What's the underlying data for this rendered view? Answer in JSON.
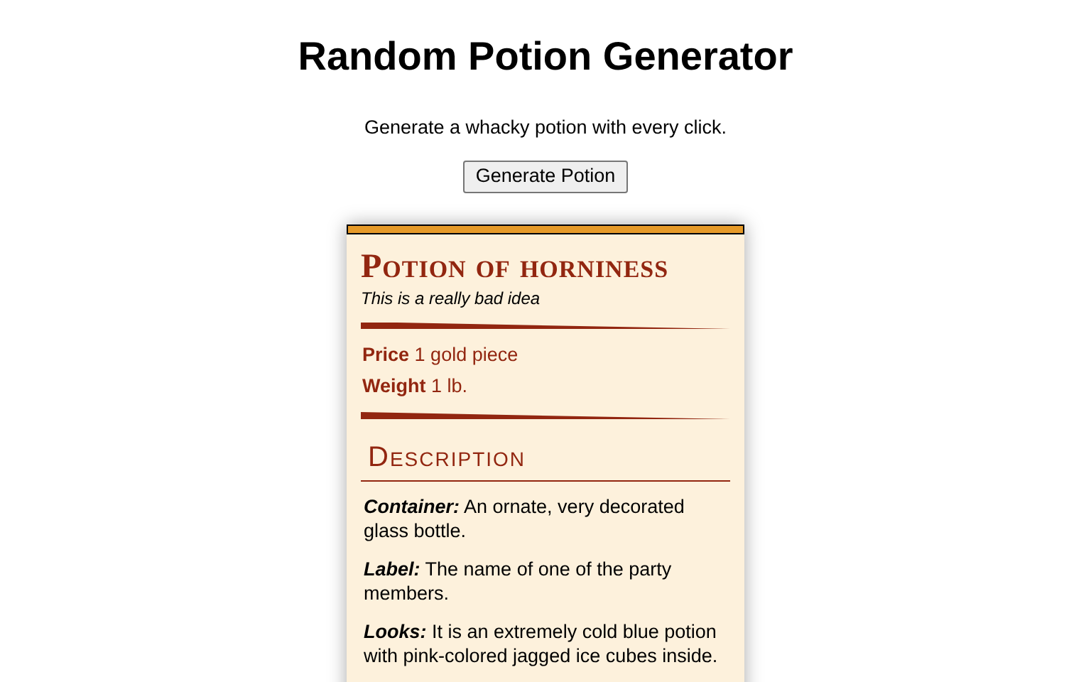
{
  "page": {
    "title": "Random Potion Generator",
    "subtitle": "Generate a whacky potion with every click."
  },
  "generate_button": {
    "label": "Generate Potion"
  },
  "potion": {
    "name": "Potion of horniness",
    "tagline": "This is a really bad idea",
    "properties": [
      {
        "label": "Price",
        "value": "1 gold piece"
      },
      {
        "label": "Weight",
        "value": "1 lb."
      }
    ],
    "section_heading": "Description",
    "details": [
      {
        "label": "Container:",
        "text": "An ornate, very decorated glass bottle."
      },
      {
        "label": "Label:",
        "text": "The name of one of the party members."
      },
      {
        "label": "Looks:",
        "text": "It is an extremely cold blue potion with pink-colored jagged ice cubes inside."
      }
    ]
  }
}
